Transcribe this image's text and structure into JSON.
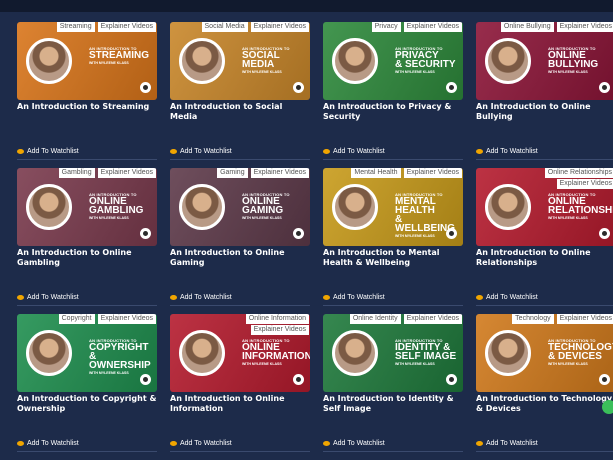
{
  "colors": {
    "background": "#1d2b4a",
    "accent": "#f0a500",
    "orange": "#d9751a",
    "pink": "#c43a68",
    "green": "#2e8a3c",
    "maroon": "#8c1538",
    "gambling": "#7a3a4d",
    "gaming": "#5e3a4a",
    "mental": "#c89b1a",
    "red": "#b51b2e"
  },
  "common": {
    "intro_label": "AN INTRODUCTION TO",
    "with_label": "WITH MYLEENE KLASS",
    "watch_label": "Add To Watchlist",
    "type_tag": "Explainer Videos"
  },
  "cards": [
    {
      "tag": "Streaming",
      "big": "STREAMING",
      "title": "An Introduction to Streaming",
      "color": "#d9751a"
    },
    {
      "tag": "Social Media",
      "big": "SOCIAL\nMEDIA",
      "title": "An Introduction to Social Media",
      "color": "#c9872a"
    },
    {
      "tag": "Privacy",
      "big": "PRIVACY\n& SECURITY",
      "title": "An Introduction to Privacy & Security",
      "color": "#2e8a3c"
    },
    {
      "tag": "Online Bullying",
      "big": "ONLINE\nBULLYING",
      "title": "An Introduction to Online Bullying",
      "color": "#8c1538"
    },
    {
      "tag": "Gambling",
      "big": "ONLINE\nGAMBLING",
      "title": "An Introduction to Online Gambling",
      "color": "#7a3a4d"
    },
    {
      "tag": "Gaming",
      "big": "ONLINE\nGAMING",
      "title": "An Introduction to Online Gaming",
      "color": "#5e3a4a"
    },
    {
      "tag": "Mental Health",
      "big": "MENTAL HEALTH\n& WELLBEING",
      "title": "An Introduction to Mental Health & Wellbeing",
      "color": "#c89b1a"
    },
    {
      "tag": "Online Relationships",
      "big": "ONLINE\nRELATIONSHIPS",
      "title": "An Introduction to Online Relationships",
      "color": "#b51b2e"
    },
    {
      "tag": "Copyright",
      "big": "COPYRIGHT\n& OWNERSHIP",
      "title": "An Introduction to Copyright & Ownership",
      "color": "#1f8f4f"
    },
    {
      "tag": "Online Information",
      "big": "ONLINE\nINFORMATION",
      "title": "An Introduction to Online Information",
      "color": "#b51b2e"
    },
    {
      "tag": "Online Identity",
      "big": "IDENTITY &\nSELF IMAGE",
      "title": "An Introduction to Identity & Self Image",
      "color": "#1f7a3c"
    },
    {
      "tag": "Technology",
      "big": "TECHNOLOGY\n& DEVICES",
      "title": "An Introduction to Technology & Devices",
      "color": "#d17a1c"
    }
  ]
}
